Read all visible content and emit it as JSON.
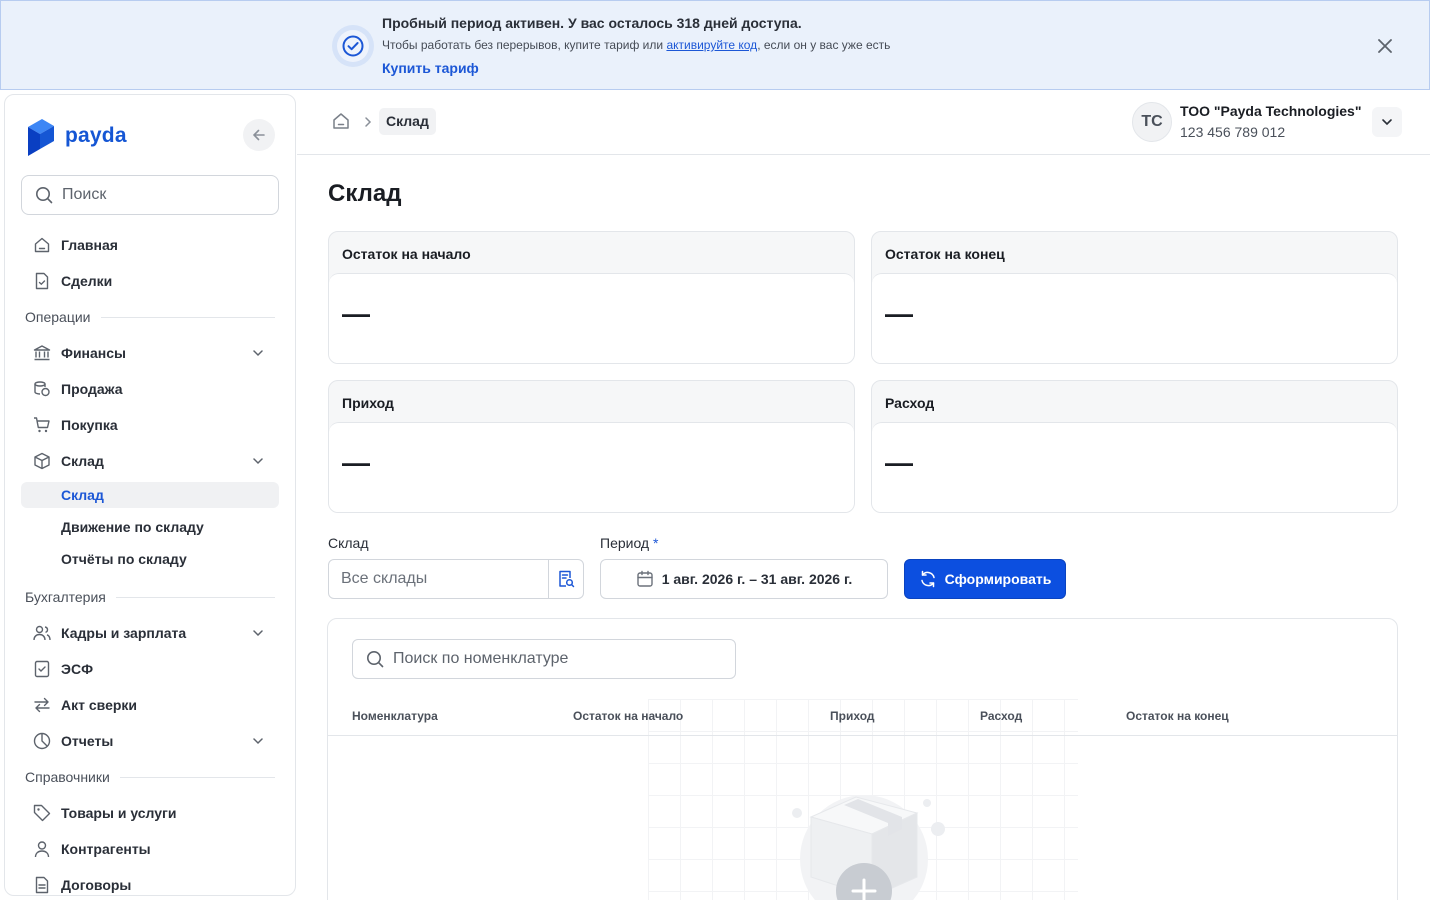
{
  "banner": {
    "title": "Пробный период активен. У вас осталось 318 дней доступа.",
    "text_before": "Чтобы работать без перерывов, купите тариф или ",
    "link_text": "активируйте код",
    "text_after": ", если он у вас уже есть",
    "cta": "Купить тариф"
  },
  "brand": {
    "name": "payda",
    "color": "#1556d4"
  },
  "sidebar": {
    "search_placeholder": "Поиск",
    "items": {
      "home": "Главная",
      "deals": "Сделки",
      "section_operations": "Операции",
      "finance": "Финансы",
      "sales": "Продажа",
      "purchase": "Покупка",
      "warehouse": "Склад",
      "warehouse_sub": "Склад",
      "warehouse_movement": "Движение по складу",
      "warehouse_reports": "Отчёты по складу",
      "section_accounting": "Бухгалтерия",
      "hr": "Кадры и зарплата",
      "esf": "ЭСФ",
      "reconciliation": "Акт сверки",
      "reports": "Отчеты",
      "section_refs": "Справочники",
      "goods": "Товары и услуги",
      "contractors": "Контрагенты",
      "contracts": "Договоры"
    }
  },
  "header": {
    "breadcrumb_current": "Склад",
    "avatar_initials": "TC",
    "company_name": "ТОО \"Payda Technologies\"",
    "company_id": "123 456 789 012"
  },
  "main": {
    "title": "Склад",
    "cards": [
      {
        "label": "Остаток на начало",
        "value": "—"
      },
      {
        "label": "Остаток на конец",
        "value": "—"
      },
      {
        "label": "Приход",
        "value": "—"
      },
      {
        "label": "Расход",
        "value": "—"
      }
    ],
    "filters": {
      "warehouse_label": "Склад",
      "warehouse_placeholder": "Все склады",
      "period_label": "Период",
      "period_required": "*",
      "period_value": "1 авг. 2026 г. – 31 авг. 2026 г.",
      "submit": "Сформировать"
    },
    "table": {
      "search_placeholder": "Поиск по номенклатуре",
      "columns": [
        "Номенклатура",
        "Остаток на начало",
        "Приход",
        "Расход",
        "Остаток на конец"
      ]
    }
  },
  "colors": {
    "accent": "#0c4fe0",
    "banner_bg": "#eaf1fb",
    "link": "#1c57d6"
  }
}
